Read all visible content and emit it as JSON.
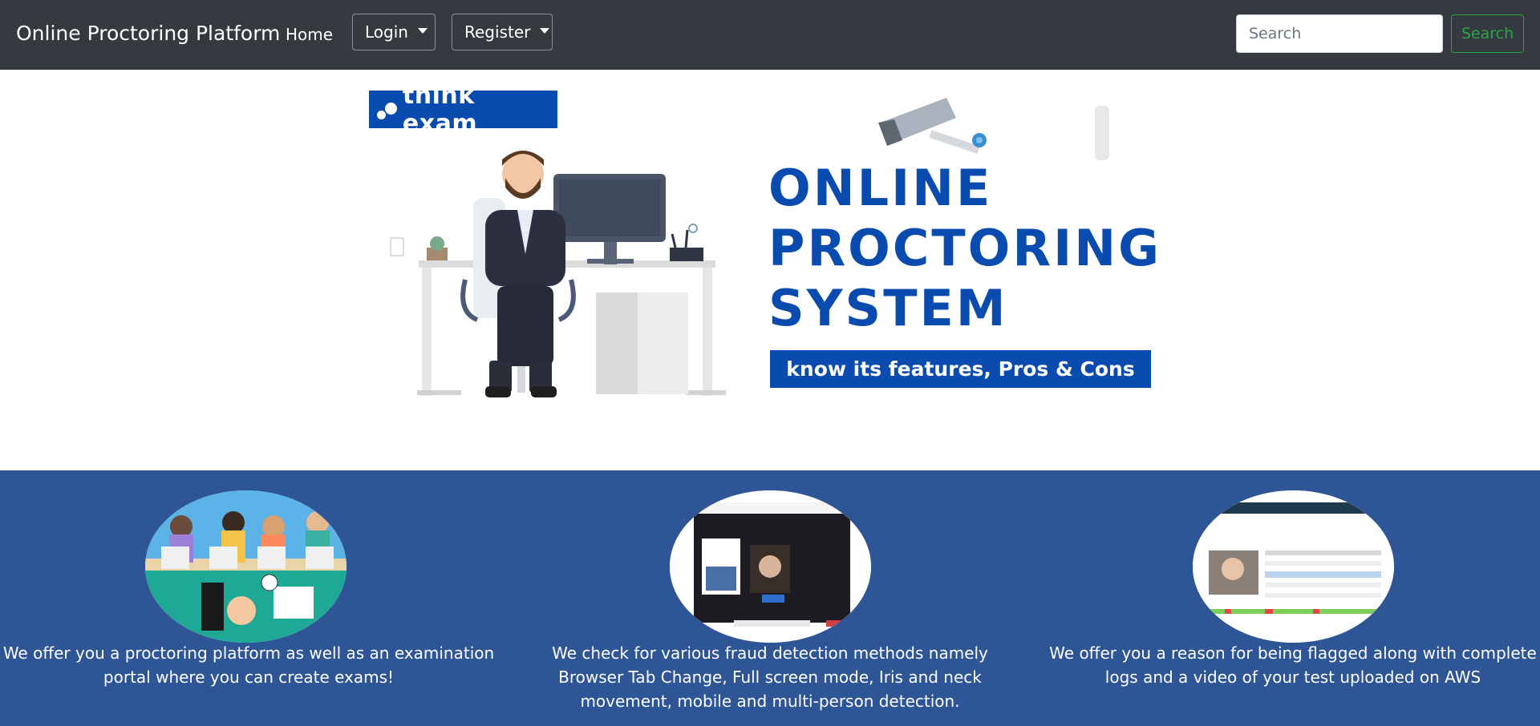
{
  "navbar": {
    "brand": "Online Proctoring Platform",
    "home_label": "Home",
    "login_label": "Login",
    "register_label": "Register",
    "search_placeholder": "Search",
    "search_button_label": "Search",
    "background_color": "#343a40",
    "search_button_color": "#28a745"
  },
  "hero": {
    "logo_text": "think exam",
    "title_lines": [
      "ONLINE",
      "PROCTORING",
      "SYSTEM"
    ],
    "tagline": "know its features, Pros & Cons",
    "brand_color": "#0a4bb0"
  },
  "features": {
    "background_color": "#2e5596",
    "items": [
      {
        "icon": "students-at-computers-illustration",
        "text": "We offer you a proctoring platform as well as an examination portal where you can create exams!"
      },
      {
        "icon": "webcam-proctoring-screenshot",
        "text": "We check for various fraud detection methods namely Browser Tab Change, Full screen mode, Iris and neck movement, mobile and multi-person detection."
      },
      {
        "icon": "exam-results-log-screenshot",
        "text": "We offer you a reason for being flagged along with complete logs and a video of your test uploaded on AWS"
      }
    ]
  }
}
